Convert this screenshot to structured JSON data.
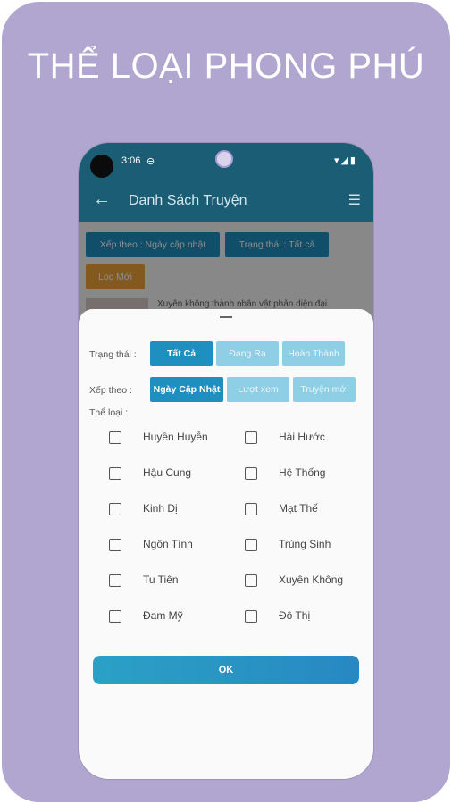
{
  "headline": "THỂ LOẠI PHONG PHÚ",
  "status_bar": {
    "time": "3:06",
    "sync_glyph": "⊖",
    "icons": "▾◢▮"
  },
  "app_bar": {
    "title": "Danh Sách Truyện"
  },
  "background_filters": {
    "sort_chip": "Xếp theo : Ngày cập nhật",
    "status_chip": "Trạng thái : Tất cả",
    "filter_button": "Lọc Mới",
    "preview_title": "Xuyên không thành nhân vật phản diện đại"
  },
  "sheet": {
    "status_label": "Trạng thái :",
    "status_options": [
      "Tất Cả",
      "Đang Ra",
      "Hoàn Thành"
    ],
    "sort_label": "Xếp theo :",
    "sort_options": [
      "Ngày Cập Nhật",
      "Lượt xem",
      "Truyện mới"
    ],
    "genre_label": "Thể loại :",
    "genres_left": [
      "Huyền Huyễn",
      "Hậu Cung",
      "Kinh Dị",
      "Ngôn Tình",
      "Tu Tiên",
      "Đam Mỹ"
    ],
    "genres_right": [
      "Hài Hước",
      "Hệ Thống",
      "Mạt Thế",
      "Trùng Sinh",
      "Xuyên Không",
      "Đô Thị"
    ],
    "ok_label": "OK"
  },
  "colors": {
    "primary": "#1a5d74",
    "accent": "#1f8fbf",
    "page_bg": "#b0a6d0"
  }
}
